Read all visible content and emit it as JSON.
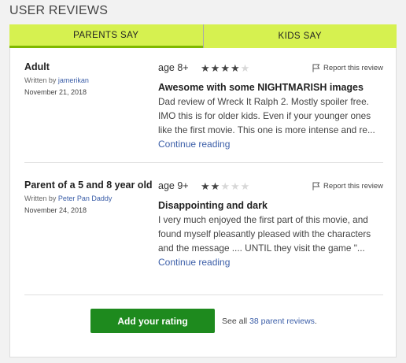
{
  "header": {
    "title": "USER REVIEWS"
  },
  "tabs": [
    {
      "label": "PARENTS SAY",
      "active": true
    },
    {
      "label": "KIDS SAY",
      "active": false
    }
  ],
  "reviews": [
    {
      "reviewer": "Adult",
      "written_by_label": "Written by",
      "author": "jamerikan",
      "date": "November 21, 2018",
      "age": "age 8+",
      "rating": 4,
      "report_label": "Report this review",
      "title": "Awesome with some NIGHTMARISH images",
      "text": "Dad review of Wreck It Ralph 2. Mostly spoiler free. IMO this is for older kids. Even if your younger ones like the first movie. This one is more intense and re...",
      "continue_label": "Continue reading"
    },
    {
      "reviewer": "Parent of a 5 and 8 year old",
      "written_by_label": "Written by",
      "author": "Peter Pan Daddy",
      "date": "November 24, 2018",
      "age": "age 9+",
      "rating": 2,
      "report_label": "Report this review",
      "title": "Disappointing and dark",
      "text": "I very much enjoyed the first part of this movie, and found myself pleasantly pleased with the characters and the message .... UNTIL they visit the game \"...",
      "continue_label": "Continue reading"
    }
  ],
  "footer": {
    "add_rating_label": "Add your rating",
    "see_all_prefix": "See all",
    "see_all_link": "38 parent reviews",
    "see_all_suffix": "."
  },
  "colors": {
    "tab_bg": "#d6f150",
    "tab_active_underline": "#7fb800",
    "button_bg": "#1e8a1e",
    "link": "#3b5ea8"
  }
}
